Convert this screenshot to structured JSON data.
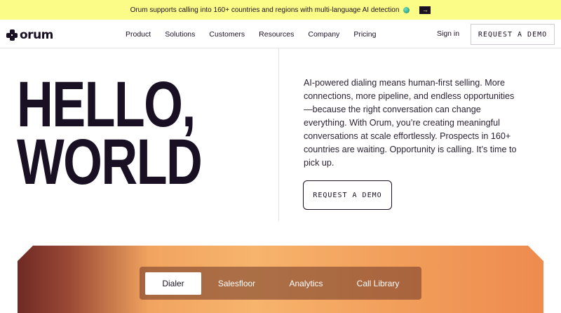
{
  "banner": {
    "text": "Orum supports calling into 160+ countries and regions with multi-language AI detection",
    "globe_icon": "globe-icon",
    "arrow_icon": "arrow-right-icon"
  },
  "nav": {
    "logo": "orum",
    "links": [
      "Product",
      "Solutions",
      "Customers",
      "Resources",
      "Company",
      "Pricing"
    ],
    "signin": "Sign in",
    "demo": "REQUEST A DEMO"
  },
  "hero": {
    "title_line1": "HELLO,",
    "title_line2": "WORLD",
    "copy": "AI-powered dialing means human-first selling. More connections, more pipeline, and endless opportunities—because the right conversation can change everything. With Orum, you’re creating meaningful conversations at scale effortlessly. Prospects in 160+ countries are waiting. Opportunity is calling. It’s time to pick up.",
    "cta": "REQUEST A DEMO"
  },
  "tabs": {
    "items": [
      "Dialer",
      "Salesfloor",
      "Analytics",
      "Call Library"
    ],
    "active": "Dialer"
  },
  "colors": {
    "banner_bg": "#fbfb87",
    "text": "#1a1024",
    "gradient_dark": "#6f2a24",
    "gradient_light": "#f7b46c"
  }
}
